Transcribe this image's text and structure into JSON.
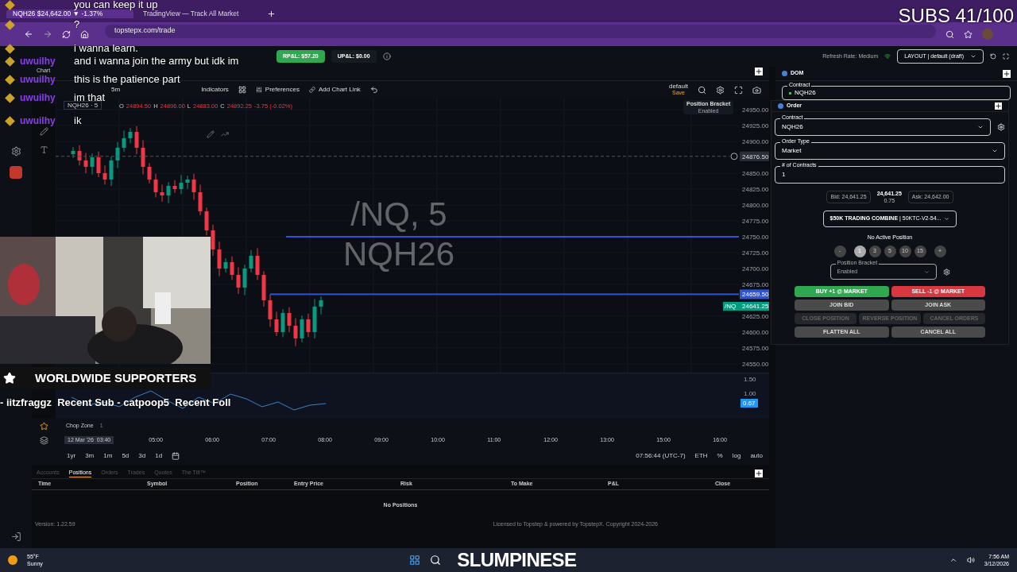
{
  "browser": {
    "tabs": [
      {
        "label": "NQH26 $24,642.00 ▼ -1.37%",
        "selected": true
      },
      {
        "label": "TradingView — Track All Market",
        "selected": false
      }
    ],
    "url": "topstepx.com/trade"
  },
  "header": {
    "rpl": "RP&L: $57.20",
    "upl": "UP&L: $0.00",
    "refresh": "Refresh Rate: Medium",
    "layout": "LAYOUT | default (draft)"
  },
  "chart": {
    "panel_tab": "Chart",
    "interval": "5m",
    "toolbar": [
      "Indicators",
      "Preferences",
      "Add Chart Link"
    ],
    "layout_name": "default",
    "save": "Save",
    "legend": {
      "symbol": "NQH26 · 5",
      "parts": [
        {
          "label": "O",
          "value": "24894.50"
        },
        {
          "label": "H",
          "value": "24896.00"
        },
        {
          "label": "L",
          "value": "24883.00"
        },
        {
          "label": "C",
          "value": "24892.25"
        }
      ],
      "change": "-3.75 (-0.02%)"
    },
    "watermark": [
      "/NQ, 5",
      "NQH26"
    ],
    "bracket_tip": {
      "title": "Position Bracket",
      "value": "Enabled"
    },
    "price_axis": [
      "24950.00",
      "24925.00",
      "24900.00",
      "24850.00",
      "24825.00",
      "24800.00",
      "24775.00",
      "24750.00",
      "24725.00",
      "24700.00",
      "24675.00",
      "24625.00",
      "24600.00",
      "24575.00",
      "24550.00"
    ],
    "crosshair_price": "24876.50",
    "line_price": "24659.50",
    "last_symbol": "/NQ",
    "last_price": "24641.25",
    "indicator": {
      "name": "Chop Zone",
      "value": "1",
      "axis": [
        "1.50",
        "1.00"
      ],
      "tag": "0.67"
    },
    "time_axis": [
      "05:00",
      "06:00",
      "07:00",
      "08:00",
      "09:00",
      "10:00",
      "11:00",
      "12:00",
      "13:00",
      "15:00",
      "16:00"
    ],
    "cursor_time": "12 Mar '26  03:40",
    "ranges": [
      "1yr",
      "3m",
      "1m",
      "5d",
      "3d",
      "1d"
    ],
    "clock": "07:56:44 (UTC-7)",
    "session": "ETH",
    "scale_options": [
      "%",
      "log",
      "auto"
    ]
  },
  "dom": {
    "tab": "DOM",
    "contract_label": "Contract",
    "contract": "NQH26"
  },
  "order": {
    "tab": "Order",
    "fields": [
      {
        "label": "Contract",
        "value": "NQH26",
        "kind": "select"
      },
      {
        "label": "Order Type",
        "value": "Market",
        "kind": "select"
      },
      {
        "label": "# of Contracts",
        "value": "1",
        "kind": "input"
      }
    ],
    "bid": "Bid: 24,641.25",
    "last": "24,641.25",
    "spread": "0.75",
    "ask": "Ask: 24,642.00",
    "account": "**$50K TRADING COMBINE** | 50KTC-V2-54...",
    "position": "No Active Position",
    "quantities": [
      {
        "label": "-",
        "selected": false
      },
      {
        "label": "1",
        "selected": true
      },
      {
        "label": "3",
        "selected": false
      },
      {
        "label": "5",
        "selected": false
      },
      {
        "label": "10",
        "selected": false
      },
      {
        "label": "15",
        "selected": false
      },
      {
        "label": "+",
        "selected": false
      }
    ],
    "bracket_label": "Position Bracket",
    "bracket": "Enabled",
    "buttons": [
      [
        {
          "label": "BUY +1 @ MARKET",
          "kind": "buy",
          "disabled": false
        },
        {
          "label": "SELL -1 @ MARKET",
          "kind": "sell",
          "disabled": false
        }
      ],
      [
        {
          "label": "JOIN BID",
          "kind": "plain",
          "disabled": false
        },
        {
          "label": "JOIN ASK",
          "kind": "plain",
          "disabled": false
        }
      ],
      [
        {
          "label": "CLOSE POSITION",
          "kind": "plain",
          "disabled": true
        },
        {
          "label": "REVERSE POSITION",
          "kind": "plain",
          "disabled": true
        },
        {
          "label": "CANCEL ORDERS",
          "kind": "plain",
          "disabled": true
        }
      ],
      [
        {
          "label": "FLATTEN ALL",
          "kind": "plain",
          "disabled": false
        },
        {
          "label": "CANCEL ALL",
          "kind": "plain",
          "disabled": false
        }
      ]
    ]
  },
  "positions": {
    "tabs": [
      {
        "label": "Accounts",
        "selected": false
      },
      {
        "label": "Positions",
        "selected": true
      },
      {
        "label": "Orders",
        "selected": false
      },
      {
        "label": "Trades",
        "selected": false
      },
      {
        "label": "Quotes",
        "selected": false
      },
      {
        "label": "The Tilt™",
        "selected": false
      }
    ],
    "columns": [
      "Time",
      "Symbol",
      "Position",
      "Entry Price",
      "Risk",
      "To Make",
      "P&L",
      "Close"
    ],
    "empty": "No Positions"
  },
  "footer": {
    "version": "Version: 1.22.59",
    "license": "Licensed to Topstep & powered by TopstepX. Copyright 2024-2026"
  },
  "taskbar": {
    "temp": "55°F",
    "weather": "Sunny",
    "time": "7:56 AM",
    "date": "3/12/2026"
  },
  "overlay": {
    "chat": [
      {
        "text": "you can keep it up"
      },
      {
        "text": "?"
      },
      {
        "text": "i wanna learn."
      },
      {
        "user": "uwuilhy",
        "text": "and i wanna join the army but idk im"
      },
      {
        "user": "uwuilhy",
        "text": "this is the patience part"
      },
      {
        "user": "uwuilhy",
        "text": "im that"
      },
      {
        "user": "uwuilhy",
        "text": "ik"
      }
    ],
    "subs": "SUBS 41/100",
    "supporters": "WORLDWIDE SUPPORTERS",
    "ticker": "- iitzfraggz  Recent Sub - catpoop5  Recent Foll",
    "logo": "SLUMPINESE"
  }
}
